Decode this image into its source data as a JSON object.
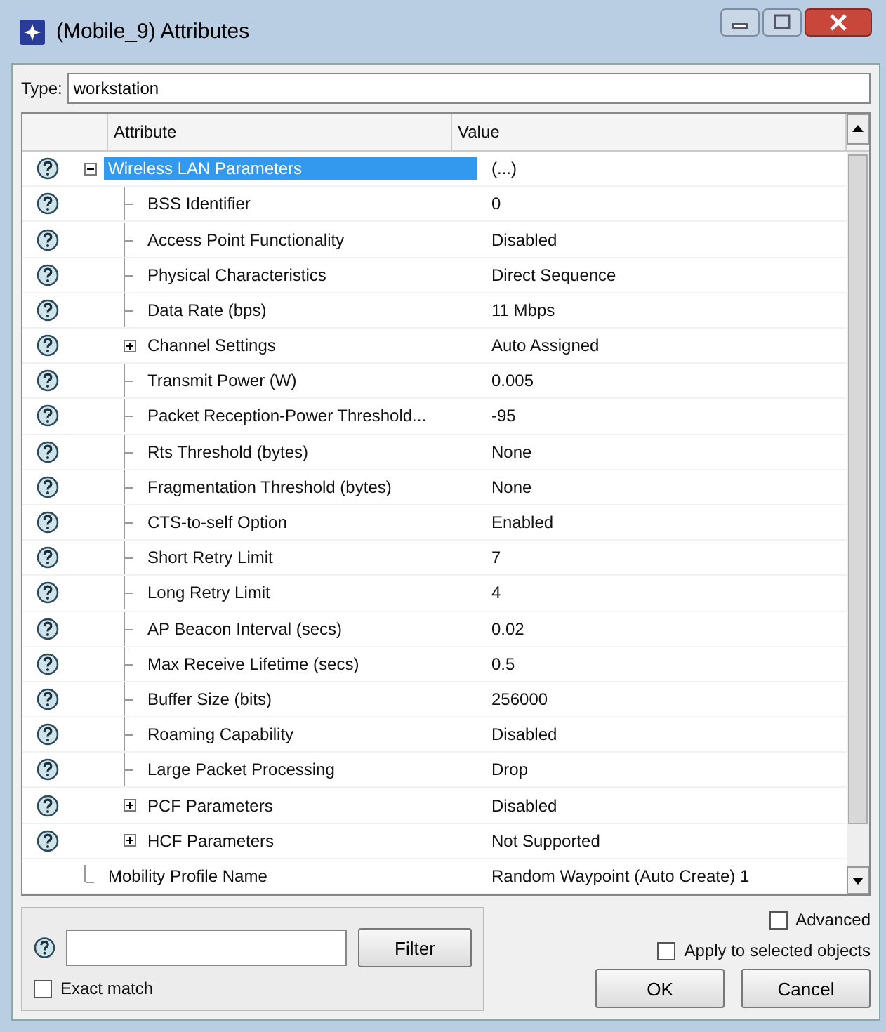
{
  "window": {
    "title": "(Mobile_9) Attributes"
  },
  "type_field": {
    "label": "Type:",
    "value": "workstation"
  },
  "table": {
    "columns": [
      "Attribute",
      "Value"
    ],
    "rows": [
      {
        "attribute": "Wireless LAN Parameters",
        "value": "(...)",
        "help": true,
        "selected": true,
        "expanded": true,
        "children": [
          {
            "attribute": "BSS Identifier",
            "value": "0",
            "help": true,
            "selected": false
          },
          {
            "attribute": "Access Point Functionality",
            "value": "Disabled",
            "help": true,
            "selected": false
          },
          {
            "attribute": "Physical Characteristics",
            "value": "Direct Sequence",
            "help": true,
            "selected": false
          },
          {
            "attribute": "Data Rate (bps)",
            "value": "11 Mbps",
            "help": true,
            "selected": false
          },
          {
            "attribute": "Channel Settings",
            "value": "Auto Assigned",
            "help": true,
            "selected": false,
            "expanded": false
          },
          {
            "attribute": "Transmit Power (W)",
            "value": "0.005",
            "help": true,
            "selected": false
          },
          {
            "attribute": "Packet Reception-Power Threshold...",
            "value": "-95",
            "help": true,
            "selected": false
          },
          {
            "attribute": "Rts Threshold (bytes)",
            "value": "None",
            "help": true,
            "selected": false
          },
          {
            "attribute": "Fragmentation Threshold (bytes)",
            "value": "None",
            "help": true,
            "selected": false
          },
          {
            "attribute": "CTS-to-self Option",
            "value": "Enabled",
            "help": true,
            "selected": false
          },
          {
            "attribute": "Short Retry Limit",
            "value": "7",
            "help": true,
            "selected": false
          },
          {
            "attribute": "Long Retry Limit",
            "value": "4",
            "help": true,
            "selected": false
          },
          {
            "attribute": "AP Beacon Interval (secs)",
            "value": "0.02",
            "help": true,
            "selected": false
          },
          {
            "attribute": "Max Receive Lifetime (secs)",
            "value": "0.5",
            "help": true,
            "selected": false
          },
          {
            "attribute": "Buffer Size (bits)",
            "value": "256000",
            "help": true,
            "selected": false
          },
          {
            "attribute": "Roaming Capability",
            "value": "Disabled",
            "help": true,
            "selected": false
          },
          {
            "attribute": "Large Packet Processing",
            "value": "Drop",
            "help": true,
            "selected": false
          },
          {
            "attribute": "PCF Parameters",
            "value": "Disabled",
            "help": true,
            "selected": false,
            "expanded": false
          },
          {
            "attribute": "HCF Parameters",
            "value": "Not Supported",
            "help": true,
            "selected": false,
            "expanded": false
          }
        ]
      },
      {
        "attribute": "Mobility Profile Name",
        "value": "Random Waypoint (Auto Create) 1",
        "help": false,
        "selected": false
      }
    ]
  },
  "filter": {
    "button": "Filter",
    "exact_match": {
      "label": "Exact match",
      "checked": false
    }
  },
  "advanced": {
    "label": "Advanced",
    "checked": false
  },
  "apply_to_selected": {
    "label": "Apply to selected objects",
    "checked": false
  },
  "buttons": [
    "OK",
    "Cancel"
  ]
}
